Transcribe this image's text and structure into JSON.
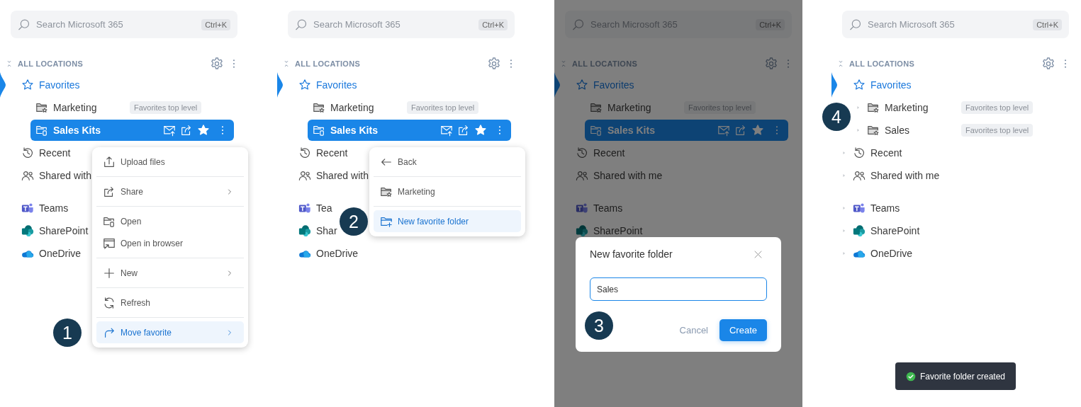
{
  "panels": [
    {
      "search": {
        "placeholder": "Search Microsoft 365",
        "shortcut": "Ctrl+K"
      },
      "header": "ALL LOCATIONS",
      "step": "1",
      "sections": [
        [
          {
            "label": "Favorites",
            "kind": "favorites",
            "current": true,
            "selected": false,
            "children": [
              {
                "label": "Marketing",
                "kind": "favorite-folder",
                "tag": "Favorites top level",
                "selected": false
              },
              {
                "label": "Sales Kits",
                "kind": "folder",
                "selected": true
              }
            ]
          },
          {
            "label": "Recent",
            "kind": "recent",
            "current": false,
            "selected": false
          },
          {
            "label": "Shared with",
            "kind": "shared",
            "current": false,
            "selected": false
          }
        ],
        [
          {
            "label": "Teams",
            "kind": "teams",
            "current": false,
            "selected": false
          },
          {
            "label": "SharePoint",
            "kind": "sharepoint",
            "current": false,
            "selected": false
          },
          {
            "label": "OneDrive",
            "kind": "onedrive",
            "current": false,
            "selected": false
          }
        ]
      ],
      "menu": {
        "groups": [
          [
            {
              "label": "Upload files",
              "kind": "upload",
              "submenu": false,
              "selected": false
            }
          ],
          [
            {
              "label": "Share",
              "kind": "share",
              "submenu": true,
              "selected": false
            }
          ],
          [
            {
              "label": "Open",
              "kind": "folder",
              "submenu": false,
              "selected": false
            },
            {
              "label": "Open in browser",
              "kind": "browser",
              "submenu": false,
              "selected": false
            }
          ],
          [
            {
              "label": "New",
              "kind": "new",
              "submenu": true,
              "selected": false
            }
          ],
          [
            {
              "label": "Refresh",
              "kind": "refresh",
              "submenu": false,
              "selected": false
            }
          ],
          [
            {
              "label": "Move favorite",
              "kind": "move",
              "submenu": true,
              "selected": true
            }
          ]
        ]
      }
    },
    {
      "search": {
        "placeholder": "Search Microsoft 365",
        "shortcut": "Ctrl+K"
      },
      "header": "ALL LOCATIONS",
      "step": "2",
      "sections": [
        [
          {
            "label": "Favorites",
            "kind": "favorites",
            "current": true,
            "selected": false,
            "children": [
              {
                "label": "Marketing",
                "kind": "favorite-folder",
                "tag": "Favorites top level",
                "selected": false
              },
              {
                "label": "Sales Kits",
                "kind": "folder",
                "selected": true
              }
            ]
          },
          {
            "label": "Recent",
            "kind": "recent",
            "current": false,
            "selected": false
          },
          {
            "label": "Shared with",
            "kind": "shared",
            "current": false,
            "selected": false
          }
        ],
        [
          {
            "label": "Tea",
            "kind": "teams",
            "current": false,
            "selected": false
          },
          {
            "label": "Shar",
            "kind": "sharepoint",
            "current": false,
            "selected": false
          },
          {
            "label": "OneDrive",
            "kind": "onedrive",
            "current": false,
            "selected": false
          }
        ]
      ],
      "menu": {
        "groups": [
          [
            {
              "label": "Back",
              "kind": "back",
              "submenu": false,
              "selected": false
            }
          ],
          [
            {
              "label": "Marketing",
              "kind": "favorite-folder",
              "submenu": false,
              "selected": false
            }
          ],
          [
            {
              "label": "New favorite folder",
              "kind": "new-folder",
              "submenu": false,
              "selected": true
            }
          ]
        ]
      }
    },
    {
      "search": {
        "placeholder": "Search Microsoft 365",
        "shortcut": "Ctrl+K"
      },
      "header": "ALL LOCATIONS",
      "step": "3",
      "sections": [
        [
          {
            "label": "Favorites",
            "kind": "favorites",
            "current": true,
            "selected": false,
            "children": [
              {
                "label": "Marketing",
                "kind": "favorite-folder",
                "tag": "Favorites top level",
                "selected": false
              },
              {
                "label": "Sales Kits",
                "kind": "folder",
                "selected": true
              }
            ]
          },
          {
            "label": "Recent",
            "kind": "recent",
            "current": false,
            "selected": false
          },
          {
            "label": "Shared with me",
            "kind": "shared",
            "current": false,
            "selected": false
          }
        ],
        [
          {
            "label": "Teams",
            "kind": "teams",
            "current": false,
            "selected": false
          },
          {
            "label": "SharePoint",
            "kind": "sharepoint",
            "current": false,
            "selected": false
          }
        ]
      ],
      "dialog": {
        "title": "New favorite folder",
        "value": "Sales",
        "focused": true,
        "buttons": [
          {
            "label": "Cancel",
            "kind": "secondary"
          },
          {
            "label": "Create",
            "kind": "primary"
          }
        ]
      }
    },
    {
      "search": {
        "placeholder": "Search Microsoft 365",
        "shortcut": "Ctrl+K"
      },
      "header": "ALL LOCATIONS",
      "step": "4",
      "sections": [
        [
          {
            "label": "Favorites",
            "kind": "favorites",
            "current": true,
            "selected": false,
            "children": [
              {
                "label": "Marketing",
                "kind": "favorite-folder",
                "tag": "Favorites top level",
                "selected": false,
                "expanded": false
              },
              {
                "label": "Sales",
                "kind": "favorite-folder",
                "tag": "Favorites top level",
                "selected": false,
                "expanded": false
              }
            ]
          },
          {
            "label": "Recent",
            "kind": "recent",
            "current": false,
            "selected": false,
            "expanded": false
          },
          {
            "label": "Shared with me",
            "kind": "shared",
            "current": false,
            "selected": false,
            "expanded": false
          }
        ],
        [
          {
            "label": "Teams",
            "kind": "teams",
            "current": false,
            "selected": false,
            "expanded": false
          },
          {
            "label": "SharePoint",
            "kind": "sharepoint",
            "current": false,
            "selected": false,
            "expanded": false
          },
          {
            "label": "OneDrive",
            "kind": "onedrive",
            "current": false,
            "selected": false,
            "expanded": false
          }
        ]
      ],
      "toast": {
        "text": "Favorite folder created"
      }
    }
  ]
}
